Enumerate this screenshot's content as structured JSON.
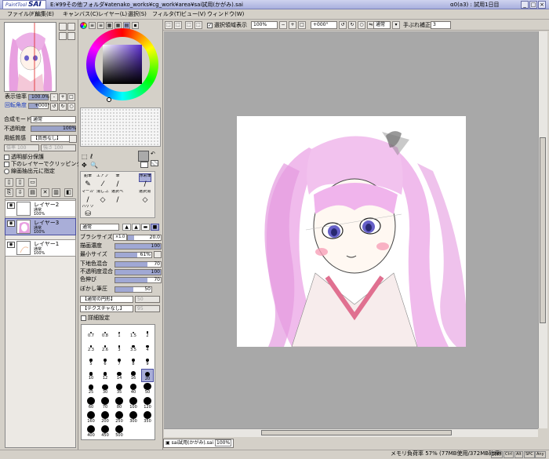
{
  "app": {
    "logo_small": "PaintTool",
    "logo_big": "SAI",
    "title": "E:¥99その他フォルダ¥atenako_works¥cg_work¥area¥sai試用(かがみ).sai",
    "version": "α0(a3) : 試用1日目",
    "win_min": "_",
    "win_max": "□",
    "win_close": "×"
  },
  "menu": [
    "ファイル(F)",
    "編集(E)",
    "キャンバス(C)",
    "レイヤー(L)",
    "選択(S)",
    "フィルタ(T)",
    "ビュー(V)",
    "ウィンドウ(W)"
  ],
  "navigator": {
    "zoom_label": "表示倍率",
    "zoom_value": "100.0%",
    "angle_label": "回転角度",
    "angle_value": "+000°",
    "zoom_out": "-",
    "zoom_in": "+",
    "zoom_reset": "□",
    "rotate_left": "↺",
    "rotate_right": "↻",
    "rotate_reset": "○"
  },
  "layer_props": {
    "blend_label": "合成モード",
    "blend_value": "通常",
    "opacity_label": "不透明度",
    "opacity_value": "100%",
    "opacity_fraction": 1.0,
    "paper_label": "用紙質感",
    "paper_value": "【質感なし】",
    "paper_scale_label": "倍率",
    "paper_scale_value": "100",
    "paper_strength_label": "強さ",
    "paper_strength_value": "100",
    "protect_alpha": "透明部分保護",
    "clip_below": "下のレイヤーでクリッピング",
    "selection_source": "線画抽出元に指定"
  },
  "layers": [
    {
      "name": "レイヤー2",
      "mode": "通常",
      "opacity": "100%",
      "selected": false
    },
    {
      "name": "レイヤー3",
      "mode": "通常",
      "opacity": "100%",
      "selected": true
    },
    {
      "name": "レイヤー1",
      "mode": "通常",
      "opacity": "100%",
      "selected": false
    }
  ],
  "tools": {
    "row1": [
      "鉛筆",
      "エアブラシ",
      "筆",
      "水彩筆"
    ],
    "row2": [
      "マーカー",
      "消しゴム",
      "選択ペン",
      "選択消し"
    ],
    "row3": [
      "バケツ"
    ],
    "selected": "水彩筆"
  },
  "brush": {
    "mode_value": "通常",
    "params": [
      {
        "label": "ブラシサイズ",
        "prefix": "×1.0",
        "value": "20.0",
        "fraction": 0.2
      },
      {
        "label": "描画濃度",
        "value": "100",
        "fraction": 1.0
      },
      {
        "label": "最小サイズ",
        "value": "61%",
        "fraction": 0.61
      },
      {
        "label": "下地色混合",
        "value": "70",
        "fraction": 0.7
      },
      {
        "label": "不透明度混合",
        "value": "100",
        "fraction": 1.0
      },
      {
        "label": "色伸び",
        "value": "70",
        "fraction": 0.7
      },
      {
        "label": "ぼかし筆圧",
        "value": "50",
        "fraction": 0.5
      }
    ],
    "shape_value": "【通常の円形】",
    "shape_strength": "50",
    "texture_value": "【テクスチャなし】",
    "texture_strength": "95",
    "detail_label": "詳細設定"
  },
  "brush_sizes": [
    "0.7",
    "0.8",
    "1",
    "1.5",
    "2",
    "2.3",
    "2.6",
    "3",
    "3.5",
    "4",
    "5",
    "6",
    "7",
    "8",
    "9",
    "10",
    "12",
    "14",
    "16",
    "20",
    "25",
    "30",
    "35",
    "40",
    "50",
    "60",
    "70",
    "80",
    "100",
    "120",
    "160",
    "200",
    "250",
    "300",
    "350",
    "400",
    "450",
    "500"
  ],
  "brush_size_selected": "20",
  "canvas_toolbar": {
    "zoom_value": "100%",
    "selection_display": "選択領域表示",
    "angle_value": "+000°",
    "blend_value": "通常",
    "stabilizer_label": "手ぶれ補正",
    "stabilizer_value": "3"
  },
  "document_tab": {
    "name": "sai試用(かがみ).sai",
    "zoom": "100%"
  },
  "status": {
    "memory": "メモリ負荷率 57% (77MB使用/372MB確保)",
    "keys": [
      "Shift",
      "Ctrl",
      "Alt",
      "SPC",
      "Any"
    ]
  },
  "colors": {
    "selection": "#a9aed8",
    "hair_pink": "#e8a0e0",
    "canvas_bg": "#a8a8a8"
  }
}
